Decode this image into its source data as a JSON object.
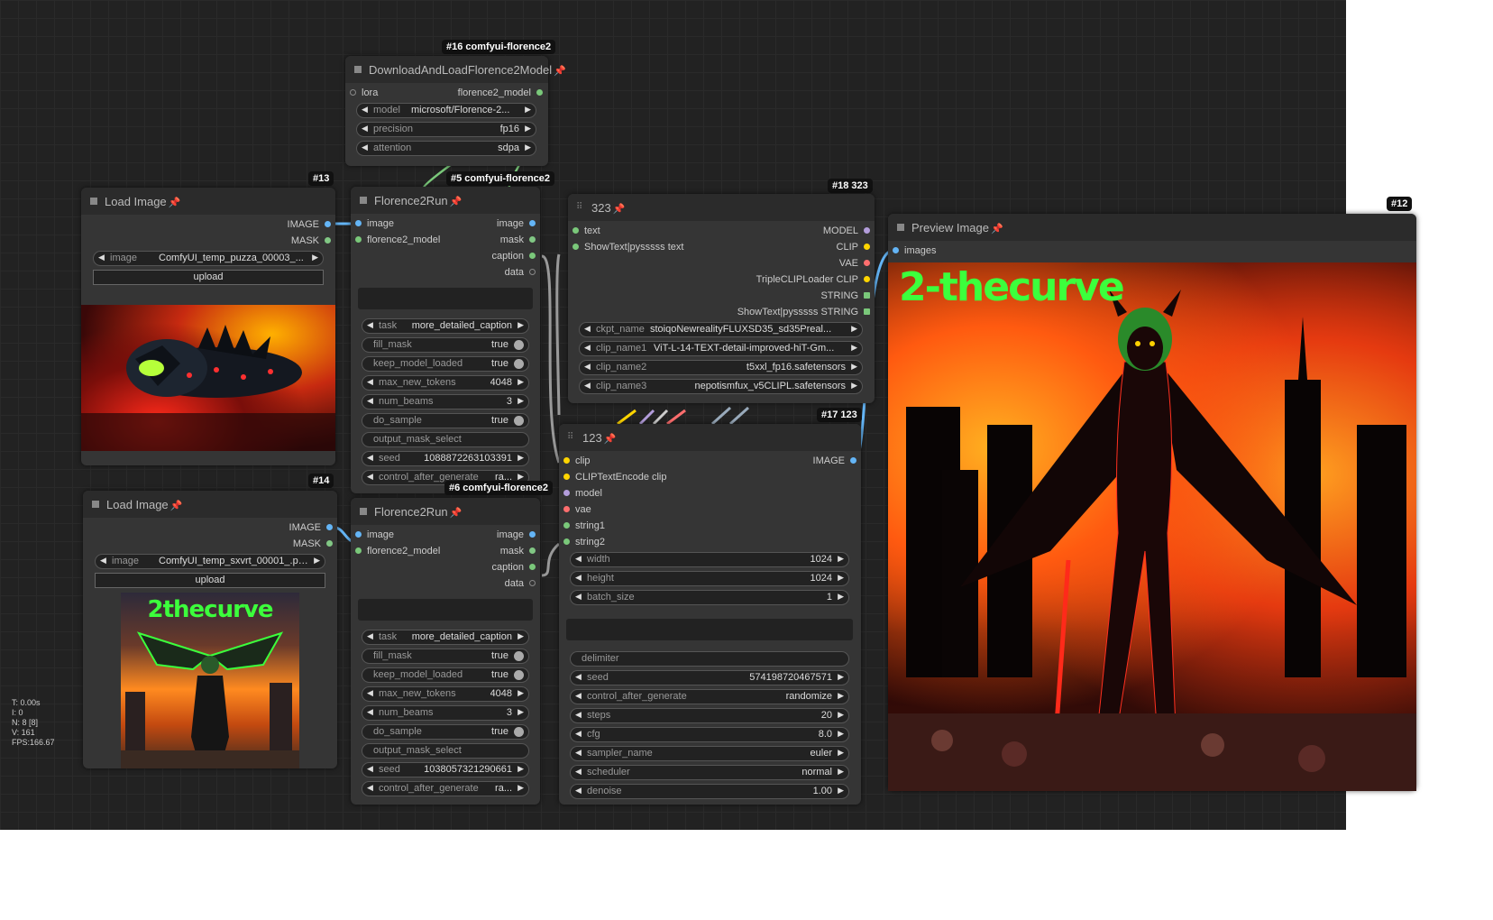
{
  "stats": [
    "T: 0.00s",
    "I: 0",
    "N: 8 [8]",
    "V: 161",
    "FPS:166.67"
  ],
  "node16": {
    "badge": "#16 comfyui-florence2",
    "title": "DownloadAndLoadFlorence2Model",
    "in_lora": "lora",
    "out_model": "florence2_model",
    "model_label": "model",
    "model_value": "microsoft/Florence-2...",
    "precision_label": "precision",
    "precision_value": "fp16",
    "attention_label": "attention",
    "attention_value": "sdpa"
  },
  "node13": {
    "badge": "#13",
    "title": "Load Image",
    "out_image": "IMAGE",
    "out_mask": "MASK",
    "image_label": "image",
    "image_value": "ComfyUI_temp_puzza_00003_...",
    "upload": "upload"
  },
  "node14": {
    "badge": "#14",
    "title": "Load Image",
    "out_image": "IMAGE",
    "out_mask": "MASK",
    "image_label": "image",
    "image_value": "ComfyUI_temp_sxvrt_00001_.png",
    "upload": "upload",
    "thumb_text": "2thecurve"
  },
  "node5": {
    "badge": "#5 comfyui-florence2",
    "title": "Florence2Run",
    "in_image": "image",
    "in_model": "florence2_model",
    "out_image": "image",
    "out_mask": "mask",
    "out_caption": "caption",
    "out_data": "data",
    "task_label": "task",
    "task_value": "more_detailed_caption",
    "fill_label": "fill_mask",
    "fill_value": "true",
    "keep_label": "keep_model_loaded",
    "keep_value": "true",
    "max_label": "max_new_tokens",
    "max_value": "4048",
    "beams_label": "num_beams",
    "beams_value": "3",
    "sample_label": "do_sample",
    "sample_value": "true",
    "oms_label": "output_mask_select",
    "seed_label": "seed",
    "seed_value": "1088872263103391",
    "cag_label": "control_after_generate",
    "cag_value": "ra..."
  },
  "node6": {
    "badge": "#6 comfyui-florence2",
    "title": "Florence2Run",
    "in_image": "image",
    "in_model": "florence2_model",
    "out_image": "image",
    "out_mask": "mask",
    "out_caption": "caption",
    "out_data": "data",
    "task_label": "task",
    "task_value": "more_detailed_caption",
    "fill_label": "fill_mask",
    "fill_value": "true",
    "keep_label": "keep_model_loaded",
    "keep_value": "true",
    "max_label": "max_new_tokens",
    "max_value": "4048",
    "beams_label": "num_beams",
    "beams_value": "3",
    "sample_label": "do_sample",
    "sample_value": "true",
    "oms_label": "output_mask_select",
    "seed_label": "seed",
    "seed_value": "1038057321290661",
    "cag_label": "control_after_generate",
    "cag_value": "ra..."
  },
  "node18": {
    "badge": "#18 323",
    "title": "323",
    "in_text": "text",
    "in_show": "ShowText|pysssss text",
    "out_model": "MODEL",
    "out_clip": "CLIP",
    "out_vae": "VAE",
    "out_triple": "TripleCLIPLoader CLIP",
    "out_string": "STRING",
    "out_showstring": "ShowText|pysssss STRING",
    "ckpt_label": "ckpt_name",
    "ckpt_value": "stoiqoNewrealityFLUXSD35_sd35Preal...",
    "clip1_label": "clip_name1",
    "clip1_value": "ViT-L-14-TEXT-detail-improved-hiT-Gm...",
    "clip2_label": "clip_name2",
    "clip2_value": "t5xxl_fp16.safetensors",
    "clip3_label": "clip_name3",
    "clip3_value": "nepotismfux_v5CLIPL.safetensors"
  },
  "node17": {
    "badge": "#17 123",
    "title": "123",
    "in_clip": "clip",
    "in_cte": "CLIPTextEncode clip",
    "in_model": "model",
    "in_vae": "vae",
    "in_s1": "string1",
    "in_s2": "string2",
    "out_image": "IMAGE",
    "width_label": "width",
    "width_value": "1024",
    "height_label": "height",
    "height_value": "1024",
    "batch_label": "batch_size",
    "batch_value": "1",
    "delim_label": "delimiter",
    "seed_label": "seed",
    "seed_value": "574198720467571",
    "cag_label": "control_after_generate",
    "cag_value": "randomize",
    "steps_label": "steps",
    "steps_value": "20",
    "cfg_label": "cfg",
    "cfg_value": "8.0",
    "sampler_label": "sampler_name",
    "sampler_value": "euler",
    "sched_label": "scheduler",
    "sched_value": "normal",
    "denoise_label": "denoise",
    "denoise_value": "1.00"
  },
  "node12": {
    "badge": "#12",
    "title": "Preview Image",
    "in_images": "images",
    "overlay_text": "2-thecurve"
  },
  "colors": {
    "image": "#64b5f6",
    "model_flor": "#7ac87a",
    "clip": "#ffd500",
    "vae": "#ff6e6e",
    "model": "#b39ddb",
    "string": "#7ac87a",
    "mask": "#81c784"
  }
}
